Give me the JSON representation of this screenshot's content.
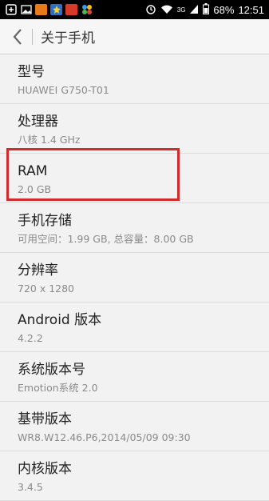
{
  "status_bar": {
    "network_label": "3G",
    "battery": "68%",
    "time": "12:51",
    "icons": [
      "plus-icon",
      "image-icon",
      "app-icon-orange",
      "app-icon-blue",
      "app-icon-red",
      "pinwheel-icon",
      "alarm-icon",
      "wifi-icon",
      "signal-icon",
      "battery-icon"
    ]
  },
  "header": {
    "title": "关于手机"
  },
  "rows": [
    {
      "label": "型号",
      "value": "HUAWEI G750-T01"
    },
    {
      "label": "处理器",
      "value": "八核 1.4 GHz"
    },
    {
      "label": "RAM",
      "value": "2.0 GB"
    },
    {
      "label": "手机存储",
      "value": "可用空间：1.99  GB, 总容量：8.00  GB"
    },
    {
      "label": "分辨率",
      "value": "720 x 1280"
    },
    {
      "label": "Android 版本",
      "value": "4.2.2"
    },
    {
      "label": "系统版本号",
      "value": "Emotion系统 2.0"
    },
    {
      "label": "基带版本",
      "value": "WR8.W12.46.P6,2014/05/09 09:30"
    },
    {
      "label": "内核版本",
      "value": "3.4.5"
    }
  ],
  "colors": {
    "highlight": "#d12b2b",
    "background": "#f2f2f2"
  }
}
